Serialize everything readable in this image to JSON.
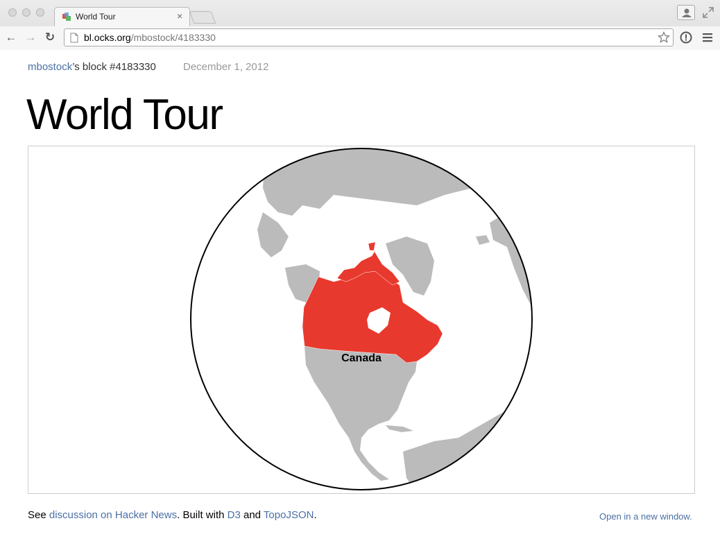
{
  "browser": {
    "tab_title": "World Tour",
    "tab_close": "×",
    "url_host": "bl.ocks.org",
    "url_path": "/mbostock/4183330",
    "back_label": "←",
    "forward_label": "→",
    "reload_label": "↻"
  },
  "page": {
    "author": "mbostock",
    "byline_rest": "’s block #4183330",
    "date": "December 1, 2012",
    "title": "World Tour"
  },
  "map": {
    "highlight_label": "Canada",
    "highlight_color": "#e8392e",
    "land_color": "#bbbbbb",
    "ocean_color": "#ffffff",
    "outline_color": "#000000"
  },
  "footer": {
    "see": "See ",
    "discussion_link": "discussion on Hacker News",
    "built_with": ". Built with ",
    "d3_link": "D3",
    "and": " and ",
    "topojson_link": "TopoJSON",
    "period": ".",
    "open_link": "Open in a new window."
  }
}
